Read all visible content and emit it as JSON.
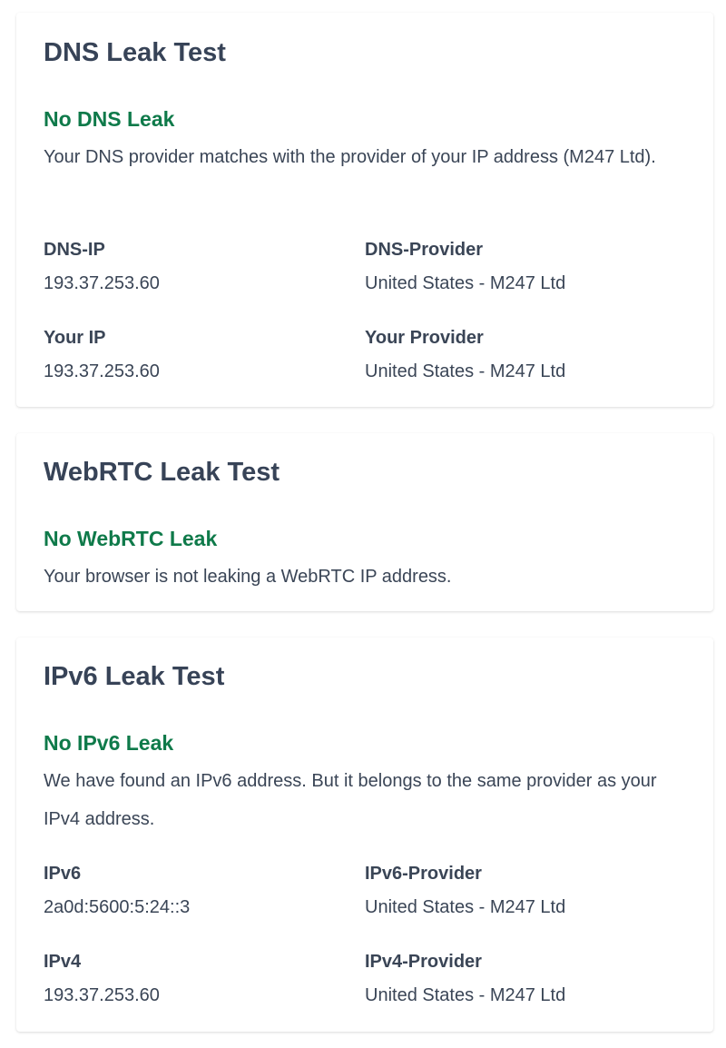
{
  "dns": {
    "title": "DNS Leak Test",
    "status": "No DNS Leak",
    "description": "Your DNS provider matches with the provider of your IP address (M247 Ltd).",
    "status_color": "#0f7a4a",
    "fields": [
      {
        "label": "DNS-IP",
        "value": "193.37.253.60"
      },
      {
        "label": "DNS-Provider",
        "value": "United States - M247 Ltd"
      },
      {
        "label": "Your IP",
        "value": "193.37.253.60"
      },
      {
        "label": "Your Provider",
        "value": "United States - M247 Ltd"
      }
    ]
  },
  "webrtc": {
    "title": "WebRTC Leak Test",
    "status": "No WebRTC Leak",
    "description": "Your browser is not leaking a WebRTC IP address."
  },
  "ipv6": {
    "title": "IPv6 Leak Test",
    "status": "No IPv6 Leak",
    "description": "We have found an IPv6 address. But it belongs to the same provider as your IPv4 address.",
    "fields": [
      {
        "label": "IPv6",
        "value": "2a0d:5600:5:24::3"
      },
      {
        "label": "IPv6-Provider",
        "value": "United States - M247 Ltd"
      },
      {
        "label": "IPv4",
        "value": "193.37.253.60"
      },
      {
        "label": "IPv4-Provider",
        "value": "United States - M247 Ltd"
      }
    ]
  }
}
